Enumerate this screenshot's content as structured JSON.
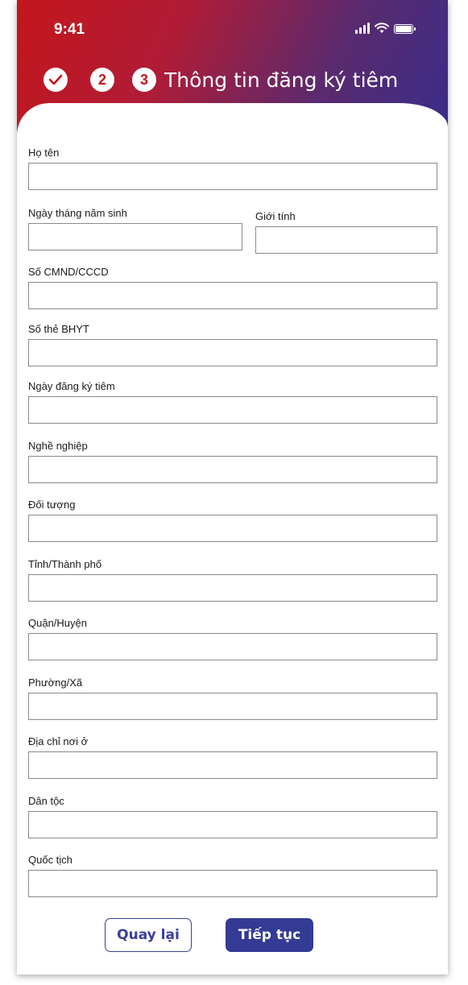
{
  "status_bar": {
    "time": "9:41"
  },
  "header": {
    "steps": [
      {
        "id": 1,
        "state": "done",
        "icon": "check-icon"
      },
      {
        "id": 2,
        "state": "pending",
        "label": "2"
      },
      {
        "id": 3,
        "state": "current",
        "label": "3"
      }
    ],
    "title": "Thông tin đăng ký tiêm",
    "gradient_colors": [
      "#c4161c",
      "#3a2d8a"
    ]
  },
  "form": {
    "ho_ten": {
      "label": "Họ tên",
      "value": ""
    },
    "ngay_sinh": {
      "label": "Ngày tháng năm sinh",
      "value": ""
    },
    "gioi_tinh": {
      "label": "Giới tính",
      "value": ""
    },
    "cmnd": {
      "label": "Số CMND/CCCD",
      "value": ""
    },
    "bhyt": {
      "label": "Số thẻ BHYT",
      "value": ""
    },
    "ngay_dang_ky": {
      "label": "Ngày đăng ký tiêm",
      "value": ""
    },
    "nghe_nghiep": {
      "label": "Nghề nghiệp",
      "value": ""
    },
    "doi_tuong": {
      "label": "Đối tượng",
      "value": ""
    },
    "tinh": {
      "label": "Tỉnh/Thành phố",
      "value": ""
    },
    "quan": {
      "label": "Quận/Huyện",
      "value": ""
    },
    "phuong": {
      "label": "Phường/Xã",
      "value": ""
    },
    "dia_chi": {
      "label": "Địa chỉ nơi ở",
      "value": ""
    },
    "dan_toc": {
      "label": "Dân tộc",
      "value": ""
    },
    "quoc_tich": {
      "label": "Quốc tịch",
      "value": ""
    }
  },
  "buttons": {
    "back": "Quay lại",
    "next": "Tiếp tục",
    "primary_color": "#343b95"
  }
}
